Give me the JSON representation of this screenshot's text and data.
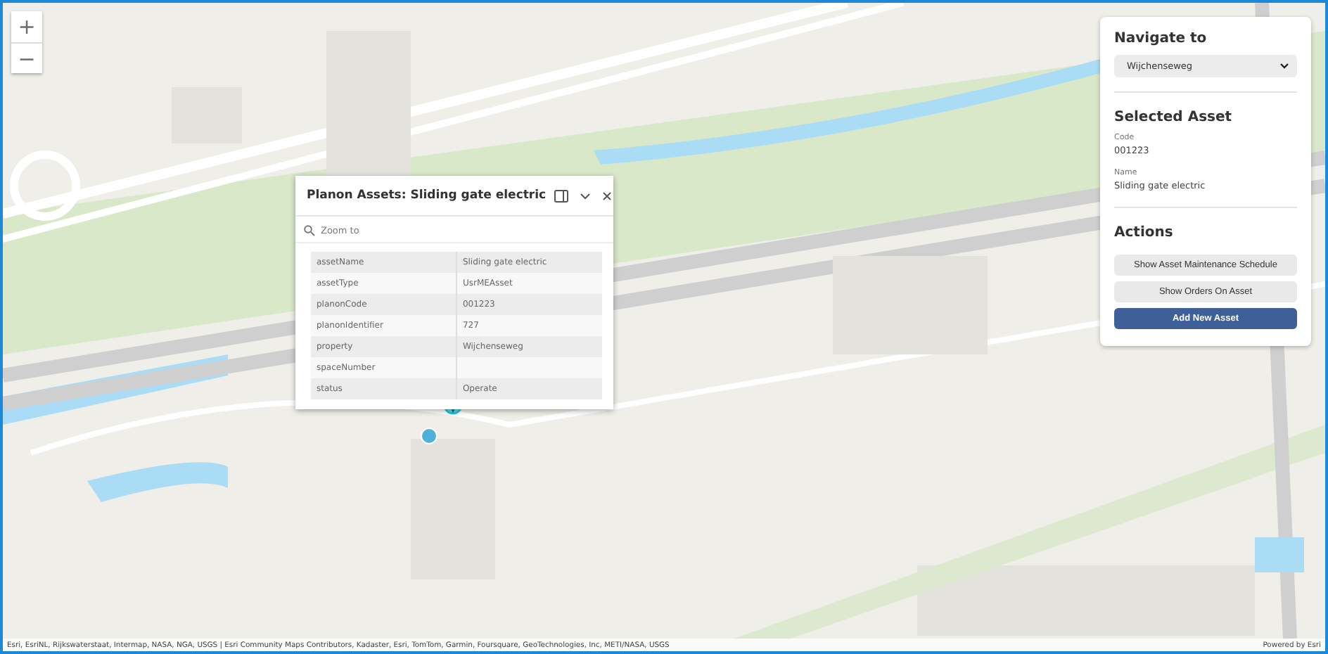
{
  "map": {
    "zoom_controls": [
      "+",
      "−"
    ]
  },
  "popup": {
    "title": "Planon Assets: Sliding gate electric",
    "zoom_action": "Zoom to",
    "fields": [
      {
        "name": "assetName",
        "value": "Sliding gate electric"
      },
      {
        "name": "assetType",
        "value": "UsrMEAsset"
      },
      {
        "name": "planonCode",
        "value": "001223"
      },
      {
        "name": "planonIdentifier",
        "value": "727"
      },
      {
        "name": "property",
        "value": "Wijchenseweg"
      },
      {
        "name": "spaceNumber"
      },
      {
        "name": "status",
        "value": "Operate"
      }
    ]
  },
  "panel": {
    "navigate": {
      "heading": "Navigate to",
      "selected": "Wijchenseweg"
    },
    "selected_asset": {
      "heading": "Selected Asset",
      "fields": [
        {
          "label": "Code",
          "value": "001223"
        },
        {
          "label": "Name",
          "value": "Sliding gate electric"
        }
      ]
    },
    "actions": {
      "heading": "Actions",
      "buttons": [
        {
          "label": "Show Asset Maintenance Schedule",
          "kind": "secondary"
        },
        {
          "label": "Show Orders On Asset",
          "kind": "secondary"
        },
        {
          "label": "Add New Asset",
          "kind": "primary"
        }
      ]
    }
  },
  "attribution": "Esri, EsriNL, Rijkswaterstaat, Intermap, NASA, NGA, USGS | Esri Community Maps Contributors, Kadaster, Esri, TomTom, Garmin, Foursquare, GeoTechnologies, Inc, METI/NASA, USGS",
  "powered_by": "Powered by Esri"
}
